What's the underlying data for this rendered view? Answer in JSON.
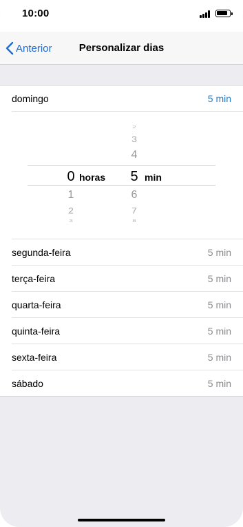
{
  "status": {
    "time": "10:00"
  },
  "nav": {
    "back_label": "Anterior",
    "title": "Personalizar dias"
  },
  "days": [
    {
      "name": "domingo",
      "value": "5 min",
      "active": true
    },
    {
      "name": "segunda-feira",
      "value": "5 min"
    },
    {
      "name": "terça-feira",
      "value": "5 min"
    },
    {
      "name": "quarta-feira",
      "value": "5 min"
    },
    {
      "name": "quinta-feira",
      "value": "5 min"
    },
    {
      "name": "sexta-feira",
      "value": "5 min"
    },
    {
      "name": "sábado",
      "value": "5 min"
    }
  ],
  "picker": {
    "hours": {
      "selected": "0",
      "unit": "horas",
      "below": [
        "1",
        "2",
        "3"
      ]
    },
    "minutes": {
      "above": [
        "2",
        "3",
        "4"
      ],
      "selected": "5",
      "unit": "min",
      "below": [
        "6",
        "7",
        "8"
      ]
    }
  },
  "colors": {
    "accent": "#1c7fd4",
    "back_link": "#1c6cd4",
    "background": "#ececf1"
  }
}
